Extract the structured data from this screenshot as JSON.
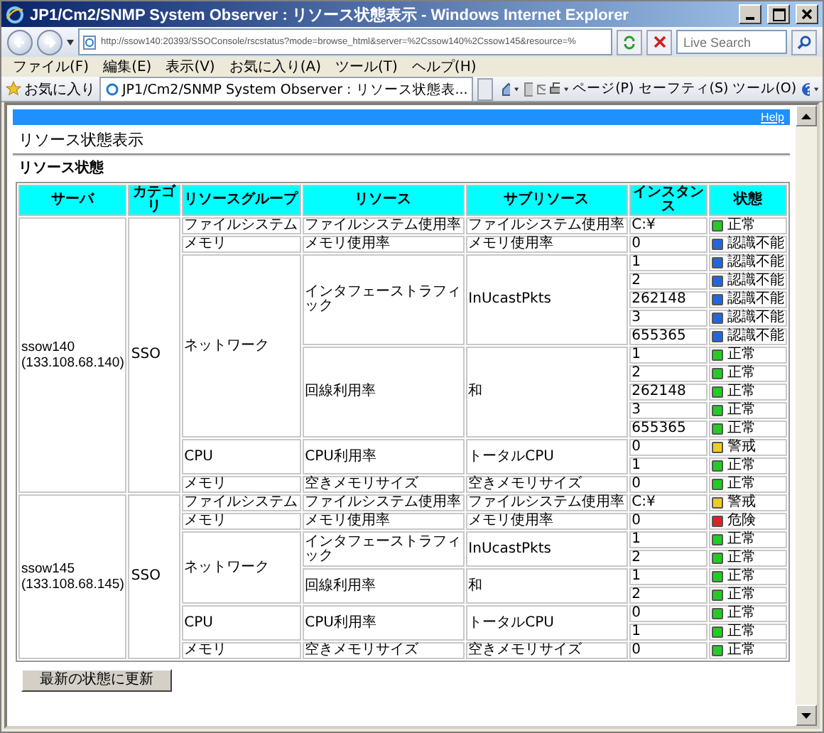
{
  "window": {
    "title": "JP1/Cm2/SNMP System Observer : リソース状態表示 - Windows Internet Explorer"
  },
  "address_bar": {
    "url": "http://ssow140:20393/SSOConsole/rscstatus?mode=browse_html&server=%2Cssow140%2Cssow145&resource=%"
  },
  "search": {
    "placeholder": "Live Search"
  },
  "menu": [
    "ファイル(F)",
    "編集(E)",
    "表示(V)",
    "お気に入り(A)",
    "ツール(T)",
    "ヘルプ(H)"
  ],
  "favorites": {
    "label": "お気に入り"
  },
  "tabs": [
    {
      "label": "JP1/Cm2/SNMP System Observer : リソース状態表...",
      "selected": true
    }
  ],
  "command_bar": [
    "ページ(P)",
    "セーフティ(S)",
    "ツール(O)"
  ],
  "page": {
    "help_link": "Help",
    "title": "リソース状態表示",
    "section": "リソース状態",
    "table": {
      "columns": [
        "サーバ",
        "カテゴリ",
        "リソースグループ",
        "リソース",
        "サブリソース",
        "インスタンス",
        "状態"
      ],
      "servers": [
        {
          "name": "ssow140",
          "address": "(133.108.68.140)",
          "category": "SSO",
          "groups": [
            {
              "name": "ファイルシステム",
              "resources": [
                {
                  "name": "ファイルシステム使用率",
                  "subresource": "ファイルシステム使用率",
                  "instances": [
                    {
                      "value": "C:¥",
                      "status": "正常",
                      "color": "#22cc22"
                    }
                  ]
                }
              ]
            },
            {
              "name": "メモリ",
              "resources": [
                {
                  "name": "メモリ使用率",
                  "subresource": "メモリ使用率",
                  "instances": [
                    {
                      "value": "0",
                      "status": "認識不能",
                      "color": "#2266dd"
                    }
                  ]
                }
              ]
            },
            {
              "name": "ネットワーク",
              "resources": [
                {
                  "name": "インタフェーストラフィック",
                  "subresource": "InUcastPkts",
                  "instances": [
                    {
                      "value": "1",
                      "status": "認識不能",
                      "color": "#2266dd"
                    },
                    {
                      "value": "2",
                      "status": "認識不能",
                      "color": "#2266dd"
                    },
                    {
                      "value": "262148",
                      "status": "認識不能",
                      "color": "#2266dd"
                    },
                    {
                      "value": "3",
                      "status": "認識不能",
                      "color": "#2266dd"
                    },
                    {
                      "value": "655365",
                      "status": "認識不能",
                      "color": "#2266dd"
                    }
                  ]
                },
                {
                  "name": "回線利用率",
                  "subresource": "和",
                  "instances": [
                    {
                      "value": "1",
                      "status": "正常",
                      "color": "#22cc22"
                    },
                    {
                      "value": "2",
                      "status": "正常",
                      "color": "#22cc22"
                    },
                    {
                      "value": "262148",
                      "status": "正常",
                      "color": "#22cc22"
                    },
                    {
                      "value": "3",
                      "status": "正常",
                      "color": "#22cc22"
                    },
                    {
                      "value": "655365",
                      "status": "正常",
                      "color": "#22cc22"
                    }
                  ]
                }
              ]
            },
            {
              "name": "CPU",
              "resources": [
                {
                  "name": "CPU利用率",
                  "subresource": "トータルCPU",
                  "instances": [
                    {
                      "value": "0",
                      "status": "警戒",
                      "color": "#eecc22"
                    },
                    {
                      "value": "1",
                      "status": "正常",
                      "color": "#22cc22"
                    }
                  ]
                }
              ]
            },
            {
              "name": "メモリ",
              "resources": [
                {
                  "name": "空きメモリサイズ",
                  "subresource": "空きメモリサイズ",
                  "instances": [
                    {
                      "value": "0",
                      "status": "正常",
                      "color": "#22cc22"
                    }
                  ]
                }
              ]
            }
          ]
        },
        {
          "name": "ssow145",
          "address": "(133.108.68.145)",
          "category": "SSO",
          "groups": [
            {
              "name": "ファイルシステム",
              "resources": [
                {
                  "name": "ファイルシステム使用率",
                  "subresource": "ファイルシステム使用率",
                  "instances": [
                    {
                      "value": "C:¥",
                      "status": "警戒",
                      "color": "#eecc22"
                    }
                  ]
                }
              ]
            },
            {
              "name": "メモリ",
              "resources": [
                {
                  "name": "メモリ使用率",
                  "subresource": "メモリ使用率",
                  "instances": [
                    {
                      "value": "0",
                      "status": "危険",
                      "color": "#dd2222"
                    }
                  ]
                }
              ]
            },
            {
              "name": "ネットワーク",
              "resources": [
                {
                  "name": "インタフェーストラフィック",
                  "subresource": "InUcastPkts",
                  "instances": [
                    {
                      "value": "1",
                      "status": "正常",
                      "color": "#22cc22"
                    },
                    {
                      "value": "2",
                      "status": "正常",
                      "color": "#22cc22"
                    }
                  ]
                },
                {
                  "name": "回線利用率",
                  "subresource": "和",
                  "instances": [
                    {
                      "value": "1",
                      "status": "正常",
                      "color": "#22cc22"
                    },
                    {
                      "value": "2",
                      "status": "正常",
                      "color": "#22cc22"
                    }
                  ]
                }
              ]
            },
            {
              "name": "CPU",
              "resources": [
                {
                  "name": "CPU利用率",
                  "subresource": "トータルCPU",
                  "instances": [
                    {
                      "value": "0",
                      "status": "正常",
                      "color": "#22cc22"
                    },
                    {
                      "value": "1",
                      "status": "正常",
                      "color": "#22cc22"
                    }
                  ]
                }
              ]
            },
            {
              "name": "メモリ",
              "resources": [
                {
                  "name": "空きメモリサイズ",
                  "subresource": "空きメモリサイズ",
                  "instances": [
                    {
                      "value": "0",
                      "status": "正常",
                      "color": "#22cc22"
                    }
                  ]
                }
              ]
            }
          ]
        }
      ]
    },
    "refresh_button": "最新の状態に更新"
  }
}
